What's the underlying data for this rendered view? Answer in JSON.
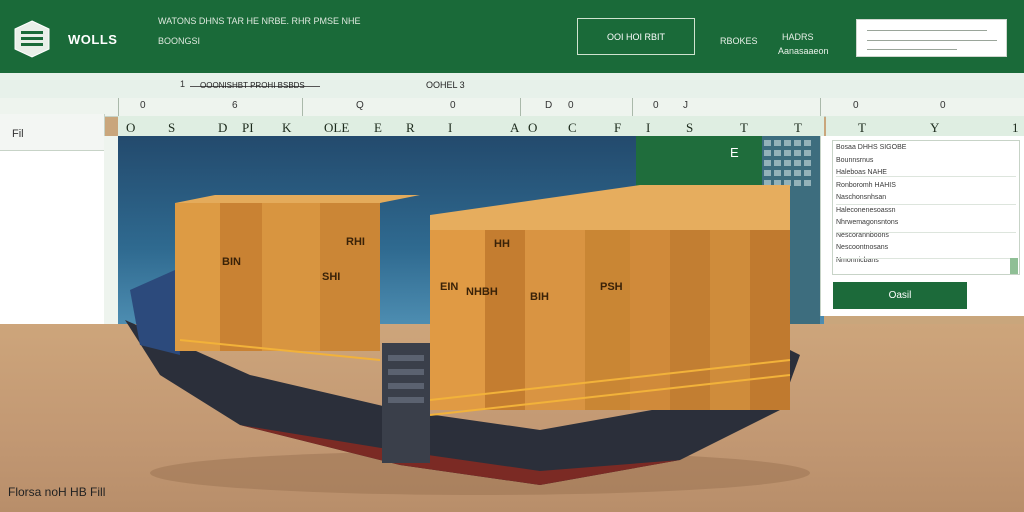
{
  "header": {
    "app_name": "WOLLS",
    "line1": "WATONS DHNS TAR HE NRBE. RHR PMSE NHE",
    "line2": "BOONGSI",
    "button_label": "OOI HOI RBIT",
    "link1": "RBOKES",
    "link2a": "HADRS",
    "link2b": "Aanasaaeon",
    "search_placeholder": ""
  },
  "formula_bar": {
    "marker": "1",
    "text": "OOONISHBT PROHI BSBDS",
    "cell_ref": "OOHEL 3"
  },
  "column_numbers": [
    "0",
    "6",
    "Q",
    "0",
    "D",
    "0",
    "0",
    "J",
    "0",
    "0"
  ],
  "row_labels": [
    "O",
    "S",
    "D",
    "PI",
    "K",
    "OLE",
    "E",
    "R",
    "I",
    "A",
    "O",
    "C",
    "F",
    "I",
    "S",
    "T",
    "T",
    "T",
    "Y",
    "1"
  ],
  "left_panel": {
    "cell": "Fil"
  },
  "scene": {
    "green_label": "E",
    "container_labels": [
      "BIN",
      "RHI",
      "EIN",
      "HH",
      "BIH",
      "NHBH",
      "PSH",
      "SHI"
    ]
  },
  "right_panel": {
    "lines": [
      "Bosaa DHHS SIGOBE",
      "Bounnsrnus",
      "Haleboas NAHE",
      "Ronboromh HAHIS",
      "Naschonsnhsan",
      "Haleconenesoassn",
      "Nhrwemagonsntons",
      "Nescorannboons",
      "Nescoontnosans",
      "Nmonnicbans"
    ],
    "button_label": "Oasil"
  },
  "footer": {
    "caption": "Florsa noH HB Fill"
  },
  "colors": {
    "brand_green": "#1a6a39",
    "container_orange": "#d9902f",
    "hull": "#2b2f3a"
  }
}
